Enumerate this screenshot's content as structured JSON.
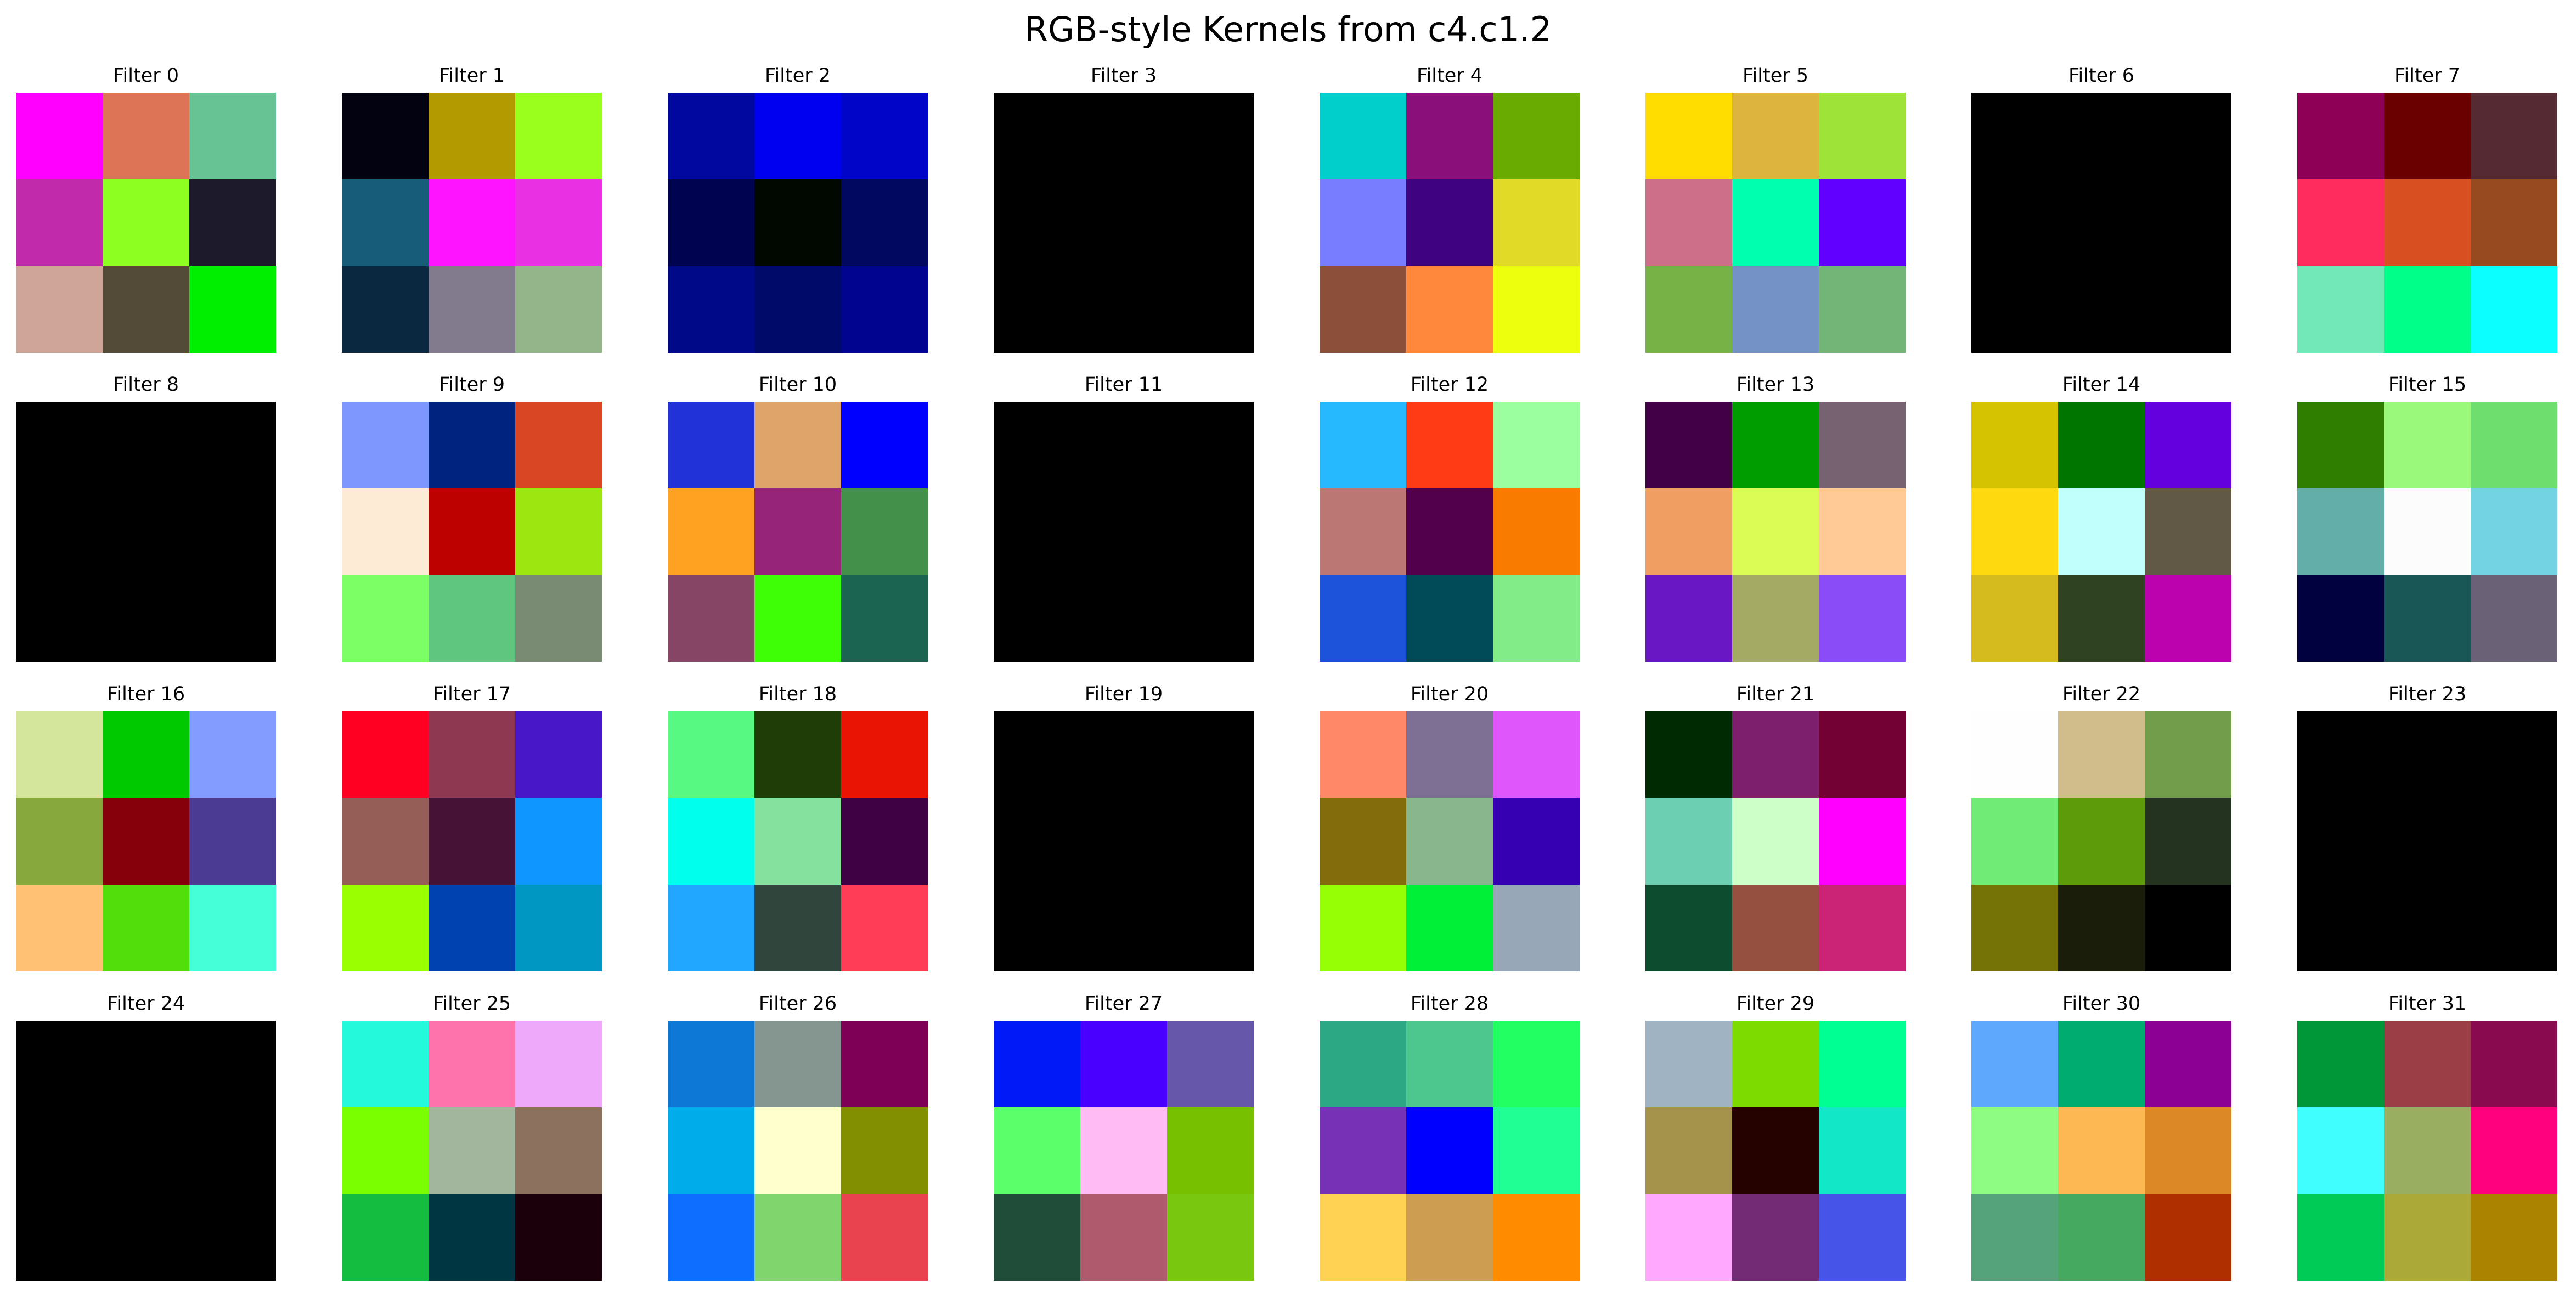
{
  "chart_data": {
    "type": "heatmap",
    "title": "RGB-style Kernels from c4.c1.2",
    "grid": false,
    "filters": [
      {
        "label": "Filter 0",
        "pixels": [
          [
            "#ff00ff",
            "#dd7456",
            "#68c394"
          ],
          [
            "#c12aab",
            "#8dff21",
            "#1d1a2b"
          ],
          [
            "#cea598",
            "#534a38",
            "#00ef00"
          ]
        ]
      },
      {
        "label": "Filter 1",
        "pixels": [
          [
            "#020210",
            "#b39a00",
            "#9bff1d"
          ],
          [
            "#175c78",
            "#ff14ff",
            "#e931e3"
          ],
          [
            "#0b2841",
            "#827a8d",
            "#94b489"
          ]
        ]
      },
      {
        "label": "Filter 2",
        "pixels": [
          [
            "#0008a0",
            "#0000f0",
            "#0005c8"
          ],
          [
            "#000350",
            "#000800",
            "#000860"
          ],
          [
            "#000a88",
            "#000a68",
            "#00048f"
          ]
        ]
      },
      {
        "label": "Filter 3",
        "pixels": [
          [
            "#000000",
            "#000000",
            "#000000"
          ],
          [
            "#000000",
            "#000000",
            "#000000"
          ],
          [
            "#000000",
            "#000000",
            "#000000"
          ]
        ]
      },
      {
        "label": "Filter 4",
        "pixels": [
          [
            "#00cfcb",
            "#8b0f7b",
            "#6aab01"
          ],
          [
            "#787dff",
            "#3f0382",
            "#e1da26"
          ],
          [
            "#8c503a",
            "#ff883c",
            "#eeff0e"
          ]
        ]
      },
      {
        "label": "Filter 5",
        "pixels": [
          [
            "#ffdd00",
            "#ddb43e",
            "#9ee337"
          ],
          [
            "#cd6f89",
            "#00ffaf",
            "#6100ff"
          ],
          [
            "#76b246",
            "#7592c6",
            "#73b576"
          ]
        ]
      },
      {
        "label": "Filter 6",
        "pixels": [
          [
            "#000000",
            "#000000",
            "#000000"
          ],
          [
            "#000000",
            "#000000",
            "#000000"
          ],
          [
            "#000000",
            "#000000",
            "#000000"
          ]
        ]
      },
      {
        "label": "Filter 7",
        "pixels": [
          [
            "#8e0055",
            "#6b0000",
            "#552a32"
          ],
          [
            "#ff2c5d",
            "#d84f21",
            "#974920"
          ],
          [
            "#72e8b8",
            "#00ff88",
            "#0bffff"
          ]
        ]
      },
      {
        "label": "Filter 8",
        "pixels": [
          [
            "#000000",
            "#000000",
            "#000000"
          ],
          [
            "#000000",
            "#000000",
            "#000000"
          ],
          [
            "#000000",
            "#000000",
            "#000000"
          ]
        ]
      },
      {
        "label": "Filter 9",
        "pixels": [
          [
            "#7e97ff",
            "#002380",
            "#d84624"
          ],
          [
            "#fdebd6",
            "#bd0000",
            "#9ee60f"
          ],
          [
            "#7cff64",
            "#5ec67e",
            "#798b72"
          ]
        ]
      },
      {
        "label": "Filter 10",
        "pixels": [
          [
            "#2132d9",
            "#dfa46a",
            "#0000ff"
          ],
          [
            "#ffa222",
            "#962478",
            "#42904a"
          ],
          [
            "#874566",
            "#3fff07",
            "#1b6452"
          ]
        ]
      },
      {
        "label": "Filter 11",
        "pixels": [
          [
            "#000000",
            "#000000",
            "#000000"
          ],
          [
            "#000000",
            "#000000",
            "#000000"
          ],
          [
            "#000000",
            "#000000",
            "#000000"
          ]
        ]
      },
      {
        "label": "Filter 12",
        "pixels": [
          [
            "#27b9fd",
            "#ff3b16",
            "#9cff9f"
          ],
          [
            "#bb7773",
            "#52004b",
            "#f97b00"
          ],
          [
            "#1d52db",
            "#004b57",
            "#82ed88"
          ]
        ]
      },
      {
        "label": "Filter 13",
        "pixels": [
          [
            "#420047",
            "#009d00",
            "#766270"
          ],
          [
            "#f19e62",
            "#dafc54",
            "#ffca96"
          ],
          [
            "#6916c5",
            "#a4aa63",
            "#8a4cf6"
          ]
        ]
      },
      {
        "label": "Filter 14",
        "pixels": [
          [
            "#d5c200",
            "#007600",
            "#6300dd"
          ],
          [
            "#ffd90f",
            "#c0fffc",
            "#615845"
          ],
          [
            "#d6bb1f",
            "#2f4221",
            "#bc02ae"
          ]
        ]
      },
      {
        "label": "Filter 15",
        "pixels": [
          [
            "#307e00",
            "#9af87b",
            "#6ede6f"
          ],
          [
            "#64aea9",
            "#fcfcfc",
            "#73d3e3"
          ],
          [
            "#010140",
            "#195656",
            "#6a6177"
          ]
        ]
      },
      {
        "label": "Filter 16",
        "pixels": [
          [
            "#d4e59c",
            "#00c900",
            "#829cff"
          ],
          [
            "#87a83c",
            "#86000b",
            "#4c3b93"
          ],
          [
            "#ffc275",
            "#51de0b",
            "#44ffd7"
          ]
        ]
      },
      {
        "label": "Filter 17",
        "pixels": [
          [
            "#ff0022",
            "#8e3852",
            "#4817c7"
          ],
          [
            "#955f58",
            "#461235",
            "#0f97ff"
          ],
          [
            "#9aff00",
            "#0042af",
            "#0097c3"
          ]
        ]
      },
      {
        "label": "Filter 18",
        "pixels": [
          [
            "#58f983",
            "#1f3d06",
            "#ea1404"
          ],
          [
            "#00ffed",
            "#85e29e",
            "#3f0044"
          ],
          [
            "#21a7ff",
            "#30463c",
            "#ff3d56"
          ]
        ]
      },
      {
        "label": "Filter 19",
        "pixels": [
          [
            "#000000",
            "#000000",
            "#000000"
          ],
          [
            "#000000",
            "#000000",
            "#000000"
          ],
          [
            "#000000",
            "#000000",
            "#000000"
          ]
        ]
      },
      {
        "label": "Filter 20",
        "pixels": [
          [
            "#ff8869",
            "#7e6f94",
            "#df57fb"
          ],
          [
            "#826c0c",
            "#8ab68d",
            "#3600b2"
          ],
          [
            "#96ff05",
            "#00ef37",
            "#97a7b7"
          ]
        ]
      },
      {
        "label": "Filter 21",
        "pixels": [
          [
            "#002a01",
            "#7e1f6e",
            "#730133"
          ],
          [
            "#6dcfb2",
            "#cdffc8",
            "#ff00ff"
          ],
          [
            "#0e4c30",
            "#955040",
            "#cb2376"
          ]
        ]
      },
      {
        "label": "Filter 22",
        "pixels": [
          [
            "#fefefe",
            "#d0bd8b",
            "#729e4b"
          ],
          [
            "#70ec76",
            "#5e9b0b",
            "#23331f"
          ],
          [
            "#757206",
            "#1a1d09",
            "#000000"
          ]
        ]
      },
      {
        "label": "Filter 23",
        "pixels": [
          [
            "#000000",
            "#000000",
            "#000000"
          ],
          [
            "#000000",
            "#000000",
            "#000000"
          ],
          [
            "#000000",
            "#000000",
            "#000000"
          ]
        ]
      },
      {
        "label": "Filter 24",
        "pixels": [
          [
            "#000000",
            "#000000",
            "#000000"
          ],
          [
            "#000000",
            "#000000",
            "#000000"
          ],
          [
            "#000000",
            "#000000",
            "#000000"
          ]
        ]
      },
      {
        "label": "Filter 25",
        "pixels": [
          [
            "#24f9dc",
            "#ff73ad",
            "#efa9fb"
          ],
          [
            "#79ff00",
            "#a1b69c",
            "#8b715e"
          ],
          [
            "#14bd3f",
            "#003642",
            "#1b000c"
          ]
        ]
      },
      {
        "label": "Filter 26",
        "pixels": [
          [
            "#0e78d7",
            "#859590",
            "#7e0056"
          ],
          [
            "#00acea",
            "#ffffce",
            "#828f00"
          ],
          [
            "#0e6eff",
            "#80d56c",
            "#e94350"
          ]
        ]
      },
      {
        "label": "Filter 27",
        "pixels": [
          [
            "#0019f6",
            "#4a00ff",
            "#6657ab"
          ],
          [
            "#5bff69",
            "#ffbcf4",
            "#76c000"
          ],
          [
            "#204d3a",
            "#b05a6d",
            "#79c80f"
          ]
        ]
      },
      {
        "label": "Filter 28",
        "pixels": [
          [
            "#2ca884",
            "#4dc78d",
            "#22ff62"
          ],
          [
            "#7631b6",
            "#0000ff",
            "#1fff94"
          ],
          [
            "#ffd253",
            "#cd9e52",
            "#ff8c00"
          ]
        ]
      },
      {
        "label": "Filter 29",
        "pixels": [
          [
            "#a0b3c3",
            "#7edb00",
            "#00ff92"
          ],
          [
            "#a6934b",
            "#250100",
            "#12e8c8"
          ],
          [
            "#ffa8fd",
            "#732b75",
            "#4655e7"
          ]
        ]
      },
      {
        "label": "Filter 30",
        "pixels": [
          [
            "#5ea8fe",
            "#00ac6f",
            "#8c0093"
          ],
          [
            "#8efb83",
            "#fdb753",
            "#dd8826"
          ],
          [
            "#55a37b",
            "#45aa5f",
            "#af2f00"
          ]
        ]
      },
      {
        "label": "Filter 31",
        "pixels": [
          [
            "#009739",
            "#9b3e45",
            "#8a0a4f"
          ],
          [
            "#40fefd",
            "#9aae62",
            "#ff007f"
          ],
          [
            "#00cb56",
            "#aba937",
            "#ab8300"
          ]
        ]
      }
    ]
  }
}
